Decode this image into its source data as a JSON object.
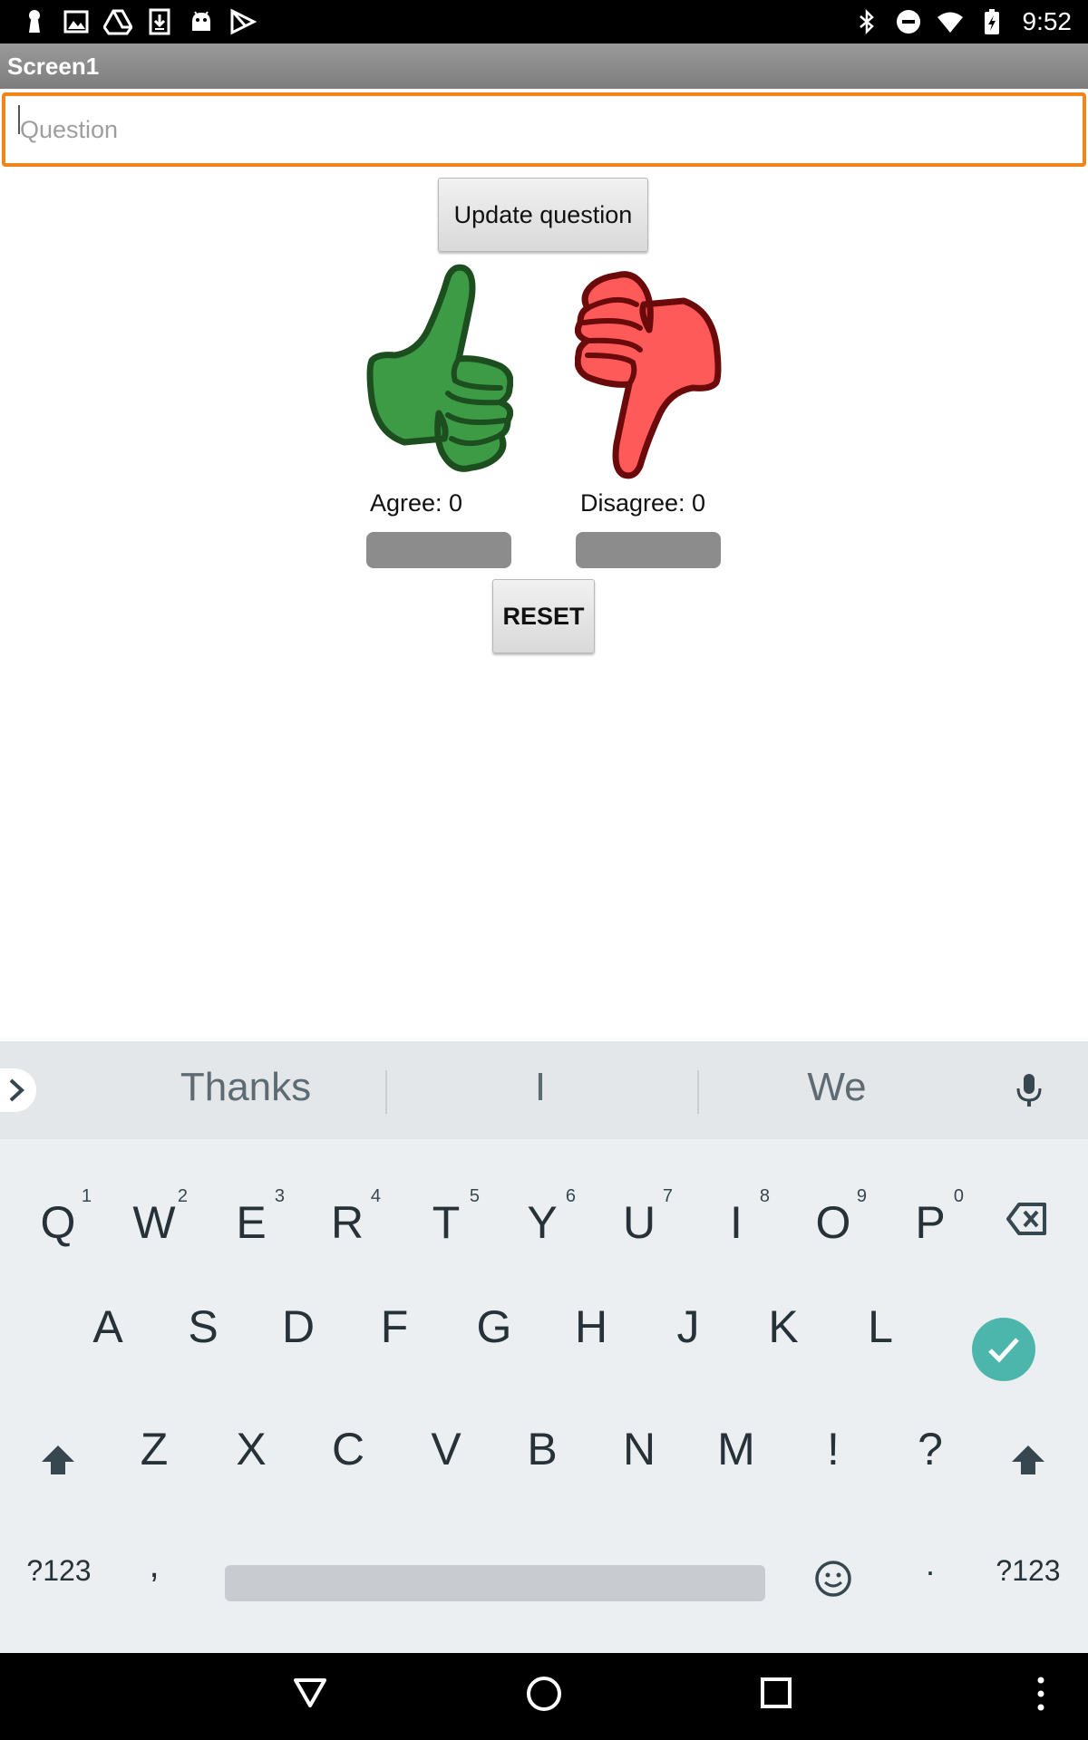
{
  "status_bar": {
    "time": "9:52",
    "left_icons": [
      "keyhole-icon",
      "image-icon",
      "drive-icon",
      "download-icon",
      "android-icon",
      "play-store-icon"
    ],
    "right_icons": [
      "bluetooth-icon",
      "do-not-disturb-icon",
      "wifi-icon",
      "battery-charging-icon"
    ]
  },
  "app": {
    "title": "Screen1",
    "question_placeholder": "Question",
    "question_value": "",
    "update_button": "Update question",
    "agree_label": "Agree: 0",
    "disagree_label": "Disagree: 0",
    "reset_button": "RESET",
    "colors": {
      "input_border": "#f0861a",
      "thumb_up_fill": "#3d9a45",
      "thumb_up_stroke": "#1d4e1f",
      "thumb_down_fill": "#ff5a5a",
      "thumb_down_stroke": "#6a0a0a"
    }
  },
  "keyboard": {
    "suggestions": [
      "Thanks",
      "I",
      "We"
    ],
    "row1": [
      {
        "key": "Q",
        "hint": "1"
      },
      {
        "key": "W",
        "hint": "2"
      },
      {
        "key": "E",
        "hint": "3"
      },
      {
        "key": "R",
        "hint": "4"
      },
      {
        "key": "T",
        "hint": "5"
      },
      {
        "key": "Y",
        "hint": "6"
      },
      {
        "key": "U",
        "hint": "7"
      },
      {
        "key": "I",
        "hint": "8"
      },
      {
        "key": "O",
        "hint": "9"
      },
      {
        "key": "P",
        "hint": "0"
      }
    ],
    "row2": [
      "A",
      "S",
      "D",
      "F",
      "G",
      "H",
      "J",
      "K",
      "L"
    ],
    "row3": [
      "Z",
      "X",
      "C",
      "V",
      "B",
      "N",
      "M",
      "!",
      "?"
    ],
    "symbols_label": "?123",
    "comma": ",",
    "period": ".",
    "enter_color": "#4db6ac"
  }
}
